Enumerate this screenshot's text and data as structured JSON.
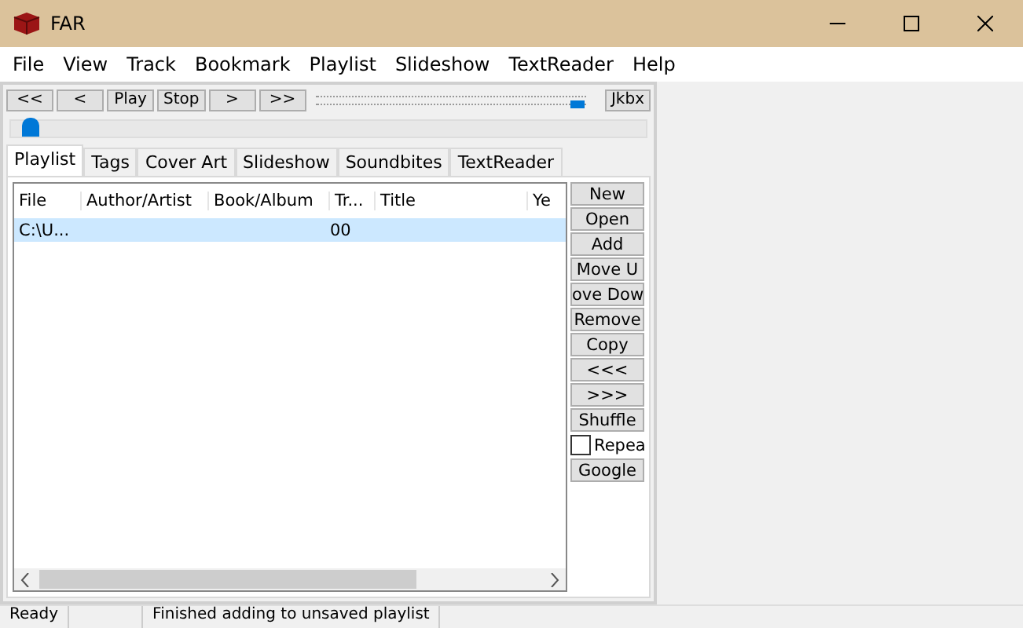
{
  "window": {
    "title": "FAR"
  },
  "menu": [
    "File",
    "View",
    "Track",
    "Bookmark",
    "Playlist",
    "Slideshow",
    "TextReader",
    "Help"
  ],
  "transport": [
    "<<",
    "<",
    "Play",
    "Stop",
    ">",
    ">>"
  ],
  "volume": {
    "level": 0.97
  },
  "jukebox_button": "Jkbx",
  "position": {
    "level": 0.02
  },
  "tabs": [
    {
      "label": "Playlist",
      "selected": true
    },
    {
      "label": "Tags",
      "selected": false
    },
    {
      "label": "Cover Art",
      "selected": false
    },
    {
      "label": "Slideshow",
      "selected": false
    },
    {
      "label": "Soundbites",
      "selected": false
    },
    {
      "label": "TextReader",
      "selected": false
    }
  ],
  "table": {
    "columns": [
      "File",
      "Author/Artist",
      "Book/Album",
      "Tr...",
      "Title",
      "Ye"
    ],
    "rows": [
      {
        "cells": [
          "C:\\U...",
          "",
          "",
          "00",
          "",
          ""
        ],
        "selected": true
      }
    ]
  },
  "side_buttons": [
    {
      "kind": "button",
      "label": "New"
    },
    {
      "kind": "button",
      "label": "Open"
    },
    {
      "kind": "button",
      "label": "Add"
    },
    {
      "kind": "button",
      "label": "Move U"
    },
    {
      "kind": "button",
      "label": "ove Dow"
    },
    {
      "kind": "button",
      "label": "Remove"
    },
    {
      "kind": "button",
      "label": "Copy"
    },
    {
      "kind": "button",
      "label": "<<<"
    },
    {
      "kind": "button",
      "label": ">>>"
    },
    {
      "kind": "button",
      "label": "Shuffle"
    },
    {
      "kind": "checkbox",
      "label": "Repea",
      "checked": false
    },
    {
      "kind": "button",
      "label": "Google"
    }
  ],
  "status_bar": [
    "Ready",
    "Finished adding to unsaved playlist"
  ]
}
